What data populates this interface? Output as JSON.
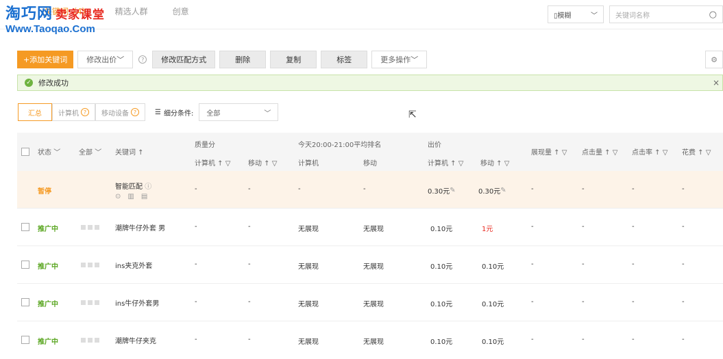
{
  "watermark": {
    "logo": "淘巧网",
    "logo_sub": "卖家课堂",
    "url": "Www.Taoqao.Com"
  },
  "tabs": [
    "关键词（4）",
    "精选人群",
    "创意"
  ],
  "device_select": {
    "icon": "phone-icon",
    "value": "模糊"
  },
  "search": {
    "placeholder": "关键词名称"
  },
  "toolbar": {
    "add": "+添加关键词",
    "modify_bid": "修改出价",
    "modify_match": "修改匹配方式",
    "delete": "删除",
    "copy": "复制",
    "tag": "标签",
    "more": "更多操作"
  },
  "success_msg": "修改成功",
  "filters": {
    "summary": "汇总",
    "computer": "计算机",
    "mobile": "移动设备",
    "segment_label": "细分条件:",
    "segment_value": "全部"
  },
  "header": {
    "status": "状态",
    "all": "全部",
    "keyword": "关键词 ↑",
    "quality": "质量分",
    "quality_pc": "计算机 ↑ ▽",
    "quality_mobile": "移动 ↑ ▽",
    "rank": "今天20:00-21:00平均排名",
    "rank_pc": "计算机",
    "rank_mobile": "移动",
    "bid": "出价",
    "bid_pc": "计算机 ↑ ▽",
    "bid_mobile": "移动 ↑ ▽",
    "impressions": "展现量 ↑ ▽",
    "clicks": "点击量 ↑ ▽",
    "ctr": "点击率 ↑ ▽",
    "cost": "花费 ↑ ▽"
  },
  "rows": [
    {
      "status": "暂停",
      "keyword": "智能匹配",
      "q_pc": "-",
      "q_m": "-",
      "r_pc": "-",
      "r_m": "-",
      "b_pc": "0.30元",
      "b_m": "0.30元",
      "imp": "-",
      "clk": "-",
      "ctr": "-",
      "cost": "-"
    },
    {
      "status": "推广中",
      "keyword": "潮牌牛仔外套 男",
      "q_pc": "-",
      "q_m": "-",
      "r_pc": "无展现",
      "r_m": "无展现",
      "b_pc": "0.10元",
      "b_m": "1元",
      "imp": "-",
      "clk": "-",
      "ctr": "-",
      "cost": "-"
    },
    {
      "status": "推广中",
      "keyword": "ins夹克外套",
      "q_pc": "-",
      "q_m": "-",
      "r_pc": "无展现",
      "r_m": "无展现",
      "b_pc": "0.10元",
      "b_m": "0.10元",
      "imp": "-",
      "clk": "-",
      "ctr": "-",
      "cost": "-"
    },
    {
      "status": "推广中",
      "keyword": "ins牛仔外套男",
      "q_pc": "-",
      "q_m": "-",
      "r_pc": "无展现",
      "r_m": "无展现",
      "b_pc": "0.10元",
      "b_m": "0.10元",
      "imp": "-",
      "clk": "-",
      "ctr": "-",
      "cost": "-"
    },
    {
      "status": "推广中",
      "keyword": "潮牌牛仔夹克",
      "q_pc": "-",
      "q_m": "-",
      "r_pc": "无展现",
      "r_m": "无展现",
      "b_pc": "0.10元",
      "b_m": "0.10元",
      "imp": "-",
      "clk": "-",
      "ctr": "-",
      "cost": "-"
    }
  ]
}
